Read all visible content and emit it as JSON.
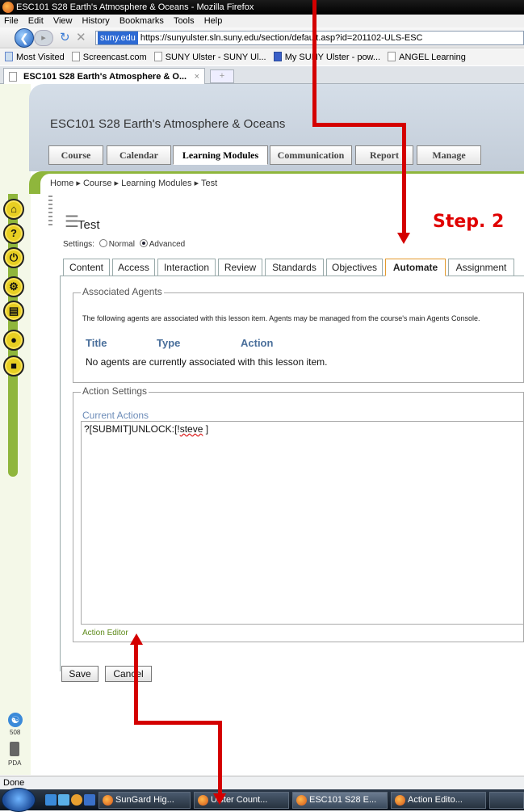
{
  "window": {
    "title": "ESC101 S28 Earth's Atmosphere & Oceans - Mozilla Firefox"
  },
  "menu": [
    "File",
    "Edit",
    "View",
    "History",
    "Bookmarks",
    "Tools",
    "Help"
  ],
  "url": {
    "site": "suny.edu",
    "address": "https://sunyulster.sln.suny.edu/section/default.asp?id=201102-ULS-ESC"
  },
  "bookmarks": [
    "Most Visited",
    "Screencast.com",
    "SUNY Ulster - SUNY Ul...",
    "My SUNY Ulster - pow...",
    "ANGEL Learning"
  ],
  "browser_tab": {
    "label": "ESC101 S28 Earth's Atmosphere & O...",
    "close": "×",
    "new": "+"
  },
  "course": {
    "title": "ESC101 S28 Earth's Atmosphere & Oceans",
    "tabs": [
      "Course",
      "Calendar",
      "Learning Modules",
      "Communication",
      "Report",
      "Manage"
    ],
    "active_tab": "Learning Modules"
  },
  "breadcrumb": "Home ▸ Course ▸ Learning Modules ▸ Test",
  "lesson": {
    "title": "Test",
    "settings_label": "Settings:",
    "mode_normal": "Normal",
    "mode_advanced": "Advanced",
    "mode_selected": "Advanced",
    "tabs": [
      "Content",
      "Access",
      "Interaction",
      "Review",
      "Standards",
      "Objectives",
      "Automate",
      "Assignment"
    ],
    "active_tab": "Automate"
  },
  "associated_agents": {
    "legend": "Associated Agents",
    "description": "The following agents are associated with this lesson item. Agents may be managed from the course's main Agents Console.",
    "columns": [
      "Title",
      "Type",
      "Action"
    ],
    "empty_message": "No agents are currently associated with this lesson item."
  },
  "action_settings": {
    "legend": "Action Settings",
    "current_actions_label": "Current Actions",
    "current_actions_prefix": "?[SUBMIT]UNLOCK:[!",
    "current_actions_name": "steve",
    "current_actions_suffix": " ]",
    "editor_link": "Action Editor"
  },
  "buttons": {
    "save": "Save",
    "cancel": "Cancel"
  },
  "side_labels": {
    "accessibility": "508",
    "pda": "PDA"
  },
  "status": "Done",
  "annotation": {
    "step": "Step. 2",
    "color": "#e00000"
  },
  "taskbar": [
    "SunGard Hig...",
    "Ulster Count...",
    "ESC101 S28 E...",
    "Action Edito..."
  ],
  "colors": {
    "course_green": "#8fb63c",
    "active_tab_border": "#e39a2d",
    "link_blue": "#4a6f9b",
    "icon_yellow": "#e8cf22"
  }
}
